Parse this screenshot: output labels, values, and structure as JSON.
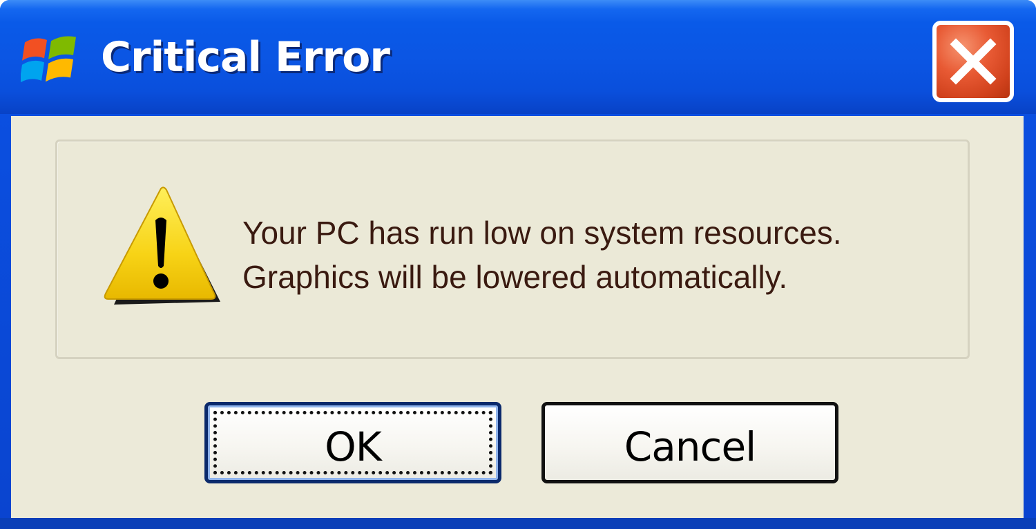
{
  "window": {
    "title": "Critical Error",
    "title_icon": "windows-logo-icon",
    "close_icon": "close-x-icon",
    "colors": {
      "titlebar": "#0b55e3",
      "client": "#ecead9",
      "close_button": "#d1421d",
      "message_text": "#3a1a10"
    }
  },
  "message": {
    "icon": "warning-triangle-icon",
    "line1": "Your PC has run low on system resources.",
    "line2": "Graphics will be lowered automatically."
  },
  "buttons": {
    "ok_label": "OK",
    "cancel_label": "Cancel"
  }
}
